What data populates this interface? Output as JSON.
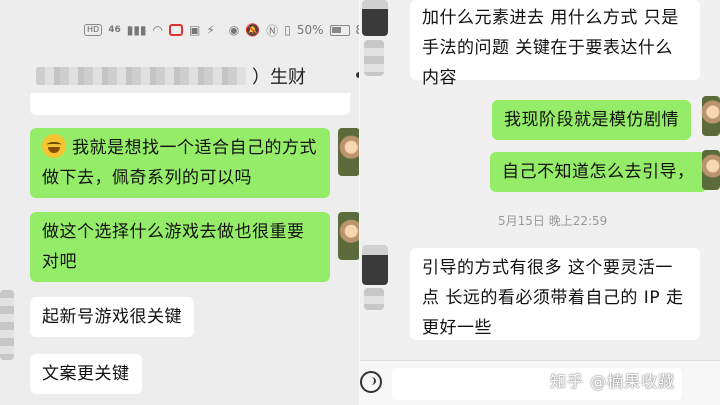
{
  "left": {
    "status": {
      "time": "",
      "hd": "HD",
      "net": "46",
      "battery": "50%",
      "tail": "8"
    },
    "header": {
      "title_suffix": "）生财"
    },
    "messages": [
      {
        "text": "我就是想找一个适合自己的方式做下去，佩奇系列的可以吗",
        "has_emoji": true
      },
      {
        "text": "做这个选择什么游戏去做也很重要对吧"
      },
      {
        "text": "起新号游戏很关键"
      },
      {
        "text": "文案更关键"
      }
    ]
  },
  "right": {
    "messages": [
      {
        "text": "加什么元素进去 用什么方式 只是手法的问题  关键在于要表达什么内容"
      },
      {
        "text": "我现阶段就是模仿剧情"
      },
      {
        "text": "自己不知道怎么去引导，"
      },
      {
        "text": "引导的方式有很多  这个要灵活一点  长远的看必须带着自己的 IP 走更好一些"
      }
    ],
    "timestamp": "5月15日 晚上22:59",
    "watermark": "知乎 @楠果收藏"
  },
  "colors": {
    "sent": "#95ec69",
    "received": "#ffffff",
    "background": "#ededed"
  }
}
